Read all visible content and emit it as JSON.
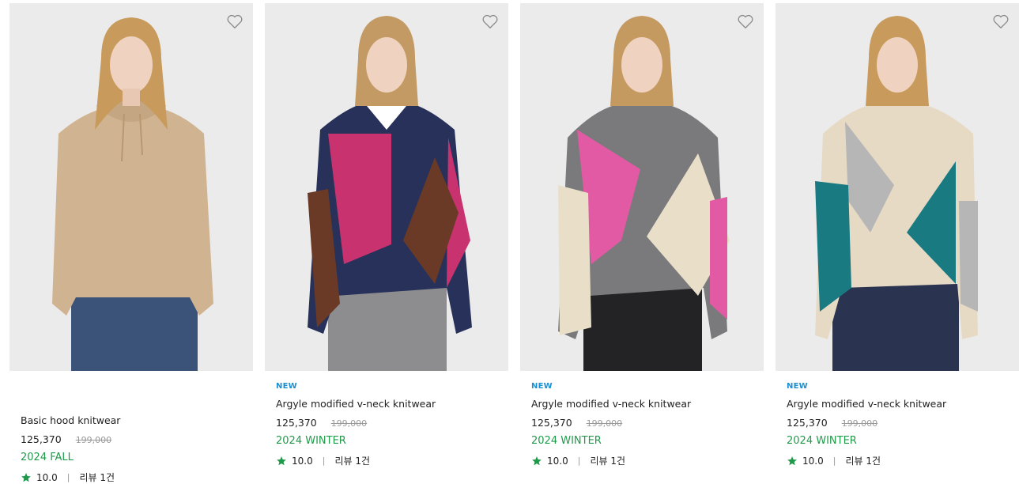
{
  "colors": {
    "badge": "#1a8fd1",
    "season": "#1f9a4a",
    "star": "#1f9a4a",
    "image_bg": "#ebebeb"
  },
  "products": [
    {
      "badge": "",
      "name": "Basic hood knitwear",
      "price": "125,370",
      "original_price": "199,000",
      "season": "2024 FALL",
      "rating": "10.0",
      "reviews": "리뷰 1건",
      "wishlist_icon": "heart-outline-icon",
      "sweater_colors": [
        "#d0b391",
        "#c5a682",
        "#b89873"
      ],
      "bottom_color": "#3b5279"
    },
    {
      "badge": "NEW",
      "name": "Argyle modified v-neck knitwear",
      "price": "125,370",
      "original_price": "199,000",
      "season": "2024 WINTER",
      "rating": "10.0",
      "reviews": "리뷰 1건",
      "wishlist_icon": "heart-outline-icon",
      "sweater_colors": [
        "#27315a",
        "#c8326f",
        "#6b3a26"
      ],
      "bottom_color": "#8d8d8f"
    },
    {
      "badge": "NEW",
      "name": "Argyle modified v-neck knitwear",
      "price": "125,370",
      "original_price": "199,000",
      "season": "2024 WINTER",
      "rating": "10.0",
      "reviews": "리뷰 1건",
      "wishlist_icon": "heart-outline-icon",
      "sweater_colors": [
        "#7a7a7d",
        "#e25aa3",
        "#e9dfc9"
      ],
      "bottom_color": "#232326"
    },
    {
      "badge": "NEW",
      "name": "Argyle modified v-neck knitwear",
      "price": "125,370",
      "original_price": "199,000",
      "season": "2024 WINTER",
      "rating": "10.0",
      "reviews": "리뷰 1건",
      "wishlist_icon": "heart-outline-icon",
      "sweater_colors": [
        "#e6dac4",
        "#1a7a82",
        "#b6b6b6"
      ],
      "bottom_color": "#2a3350"
    }
  ]
}
